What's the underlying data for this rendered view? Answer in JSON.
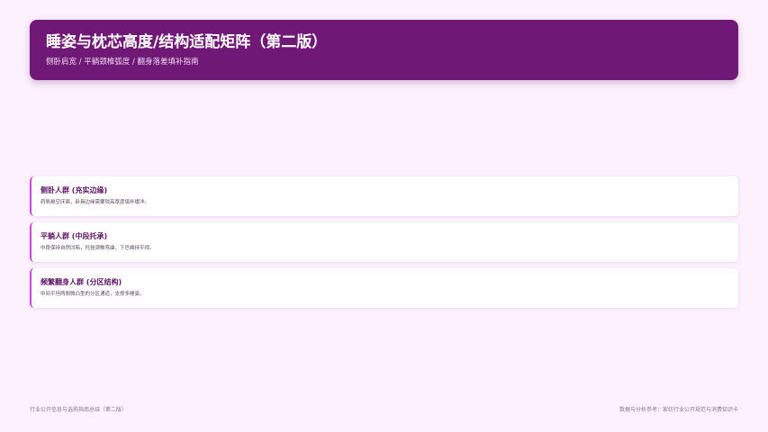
{
  "header": {
    "title": "睡姿与枕芯高度/结构适配矩阵（第二版）",
    "subtitle": "侧卧肩宽 / 平躺颈椎弧度 / 翻身落差填补指南"
  },
  "cards": [
    {
      "title": "侧卧人群 (充实边缘)",
      "desc": "肩侧悬空床面，卧具边缘需要较高厚度填补缓冲。"
    },
    {
      "title": "平躺人群 (中段托承)",
      "desc": "中段保持自然凹陷，托挂颈椎弯曲，下巴维持平视。"
    },
    {
      "title": "频繁翻身人群 (分区结构)",
      "desc": "中间平坦两侧微凸型的分区通道，支撑多睡姿。"
    }
  ],
  "footer": {
    "left": "行业公开信息与选购指南总结（第二版）",
    "right": "数据与分析参考：家纺行业公开规范与消费知识卡"
  },
  "colors": {
    "background": "#fcf1fd",
    "header": "#6f1876",
    "accent": "#c84dd4",
    "card_title": "#5e1566"
  }
}
